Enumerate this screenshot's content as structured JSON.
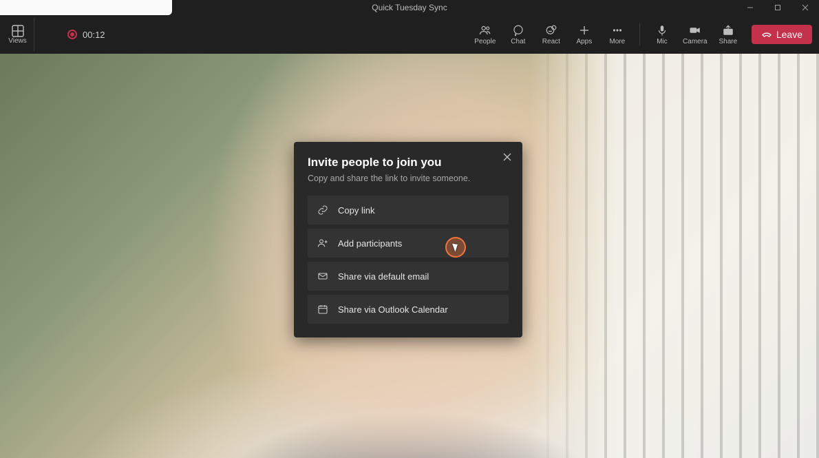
{
  "titlebar": {
    "meeting_title": "Quick Tuesday Sync"
  },
  "toolbar": {
    "views_label": "Views",
    "recording_time": "00:12",
    "items": {
      "people": "People",
      "chat": "Chat",
      "react": "React",
      "apps": "Apps",
      "more": "More",
      "mic": "Mic",
      "camera": "Camera",
      "share": "Share"
    },
    "leave_label": "Leave"
  },
  "modal": {
    "title": "Invite people to join you",
    "subtitle": "Copy and share the link to invite someone.",
    "options": {
      "copy_link": "Copy link",
      "add_participants": "Add participants",
      "share_email": "Share via default email",
      "share_outlook": "Share via Outlook Calendar"
    }
  }
}
